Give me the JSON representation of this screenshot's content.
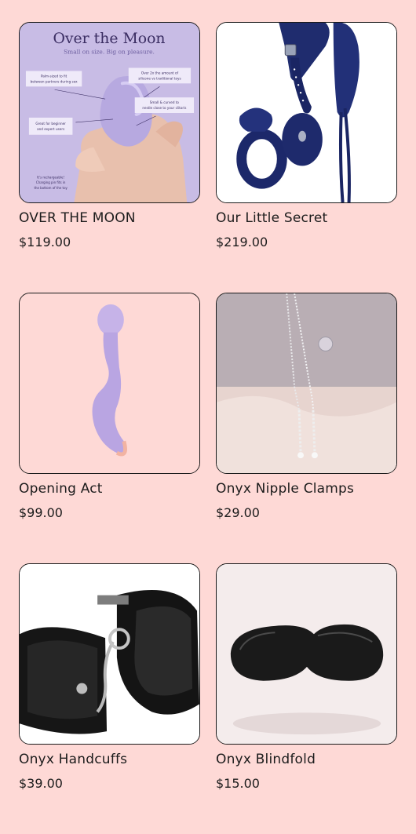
{
  "products": [
    {
      "title": "OVER THE MOON",
      "price": "$119.00",
      "image_text": {
        "heading": "Over the Moon",
        "subheading": "Small on size. Big on pleasure.",
        "callout_1": "Palm-sized to fit between partners during sex",
        "callout_2": "Over 2x the amount of silicone vs traditional toys",
        "callout_3": "Small & curved to nestle close to your clitoris",
        "callout_4": "Great for beginner and expert users",
        "callout_5": "It's rechargeable! Charging pin fits in the bottom of the toy"
      }
    },
    {
      "title": "Our Little Secret",
      "price": "$219.00"
    },
    {
      "title": "Opening Act",
      "price": "$99.00"
    },
    {
      "title": "Onyx Nipple Clamps",
      "price": "$29.00"
    },
    {
      "title": "Onyx Handcuffs",
      "price": "$39.00"
    },
    {
      "title": "Onyx Blindfold",
      "price": "$15.00"
    }
  ],
  "colors": {
    "page_background": "#fed9d6",
    "card_border": "#1a1a1a",
    "text": "#1c1c1c"
  }
}
